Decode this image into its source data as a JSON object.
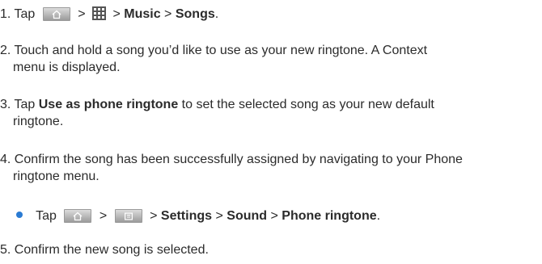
{
  "step1": {
    "num": "1.",
    "tap": "Tap",
    "sep1": ">",
    "sep2": ">",
    "music": "Music",
    "sep3": ">",
    "songs": "Songs",
    "end": "."
  },
  "step2": {
    "num": "2.",
    "line1": "Touch and hold a song you’d like to use as your new ringtone. A Context",
    "line2": "menu is displayed."
  },
  "step3": {
    "num": "3.",
    "tap": "Tap",
    "bold": "Use as phone ringtone",
    "line1_rest": "to set the selected song as your new default",
    "line2": "ringtone."
  },
  "step4": {
    "num": "4.",
    "line1": "Confirm the song has been successfully assigned by navigating to your Phone",
    "line2": "ringtone menu."
  },
  "bullet": {
    "tap": "Tap",
    "sep1": ">",
    "sep2": ">",
    "settings": "Settings",
    "sep3": ">",
    "sound": "Sound",
    "sep4": ">",
    "phone_ringtone": "Phone ringtone",
    "end": "."
  },
  "step5": {
    "num": "5.",
    "line1": "Confirm the new song is selected."
  },
  "icons": {
    "home_key": "home-icon",
    "apps_key": "apps-grid-icon",
    "menu_key": "menu-icon"
  },
  "colors": {
    "text": "#2b2b2b",
    "bullet": "#2a7bd3"
  }
}
